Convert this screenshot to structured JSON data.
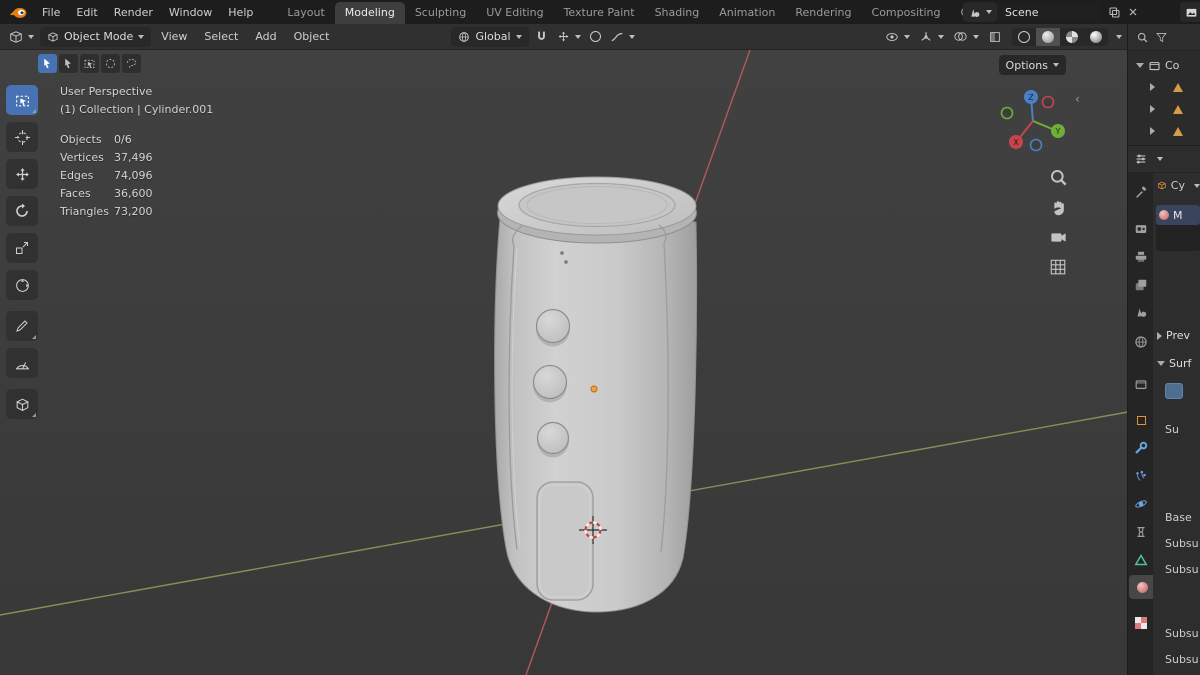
{
  "topbar": {
    "menus": [
      "File",
      "Edit",
      "Render",
      "Window",
      "Help"
    ],
    "tabs": [
      "Layout",
      "Modeling",
      "Sculpting",
      "UV Editing",
      "Texture Paint",
      "Shading",
      "Animation",
      "Rendering",
      "Compositing",
      "Geometry Nod"
    ],
    "active_tab": "Modeling",
    "scene_name": "Scene"
  },
  "header": {
    "mode": "Object Mode",
    "menus": [
      "View",
      "Select",
      "Add",
      "Object"
    ],
    "orientation": "Global",
    "options_label": "Options"
  },
  "viewport": {
    "perspective_label": "User Perspective",
    "context_label": "(1) Collection | Cylinder.001",
    "stats": [
      {
        "label": "Objects",
        "value": "0/6"
      },
      {
        "label": "Vertices",
        "value": "37,496"
      },
      {
        "label": "Edges",
        "value": "74,096"
      },
      {
        "label": "Faces",
        "value": "36,600"
      },
      {
        "label": "Triangles",
        "value": "73,200"
      }
    ],
    "axes": {
      "x": "X",
      "y": "Y",
      "z": "Z"
    }
  },
  "outliner": {
    "root_label": "Co"
  },
  "properties": {
    "breadcrumb": "Cy",
    "material_slot": "M",
    "preview_section": "Prev",
    "surface_section": "Surf",
    "fields": [
      "Su",
      "Base",
      "Subsu",
      "Subsu",
      "Subsu",
      "Subsu"
    ]
  },
  "colors": {
    "accent_blue": "#4772b3",
    "blender_orange": "#e87d0d",
    "axis_red": "#c75f5f",
    "axis_green": "#97a65e",
    "material_pink": "#d97b7b",
    "data_green": "#55c092",
    "modifier_blue": "#6ba6e3",
    "object_orange": "#e5903f"
  }
}
